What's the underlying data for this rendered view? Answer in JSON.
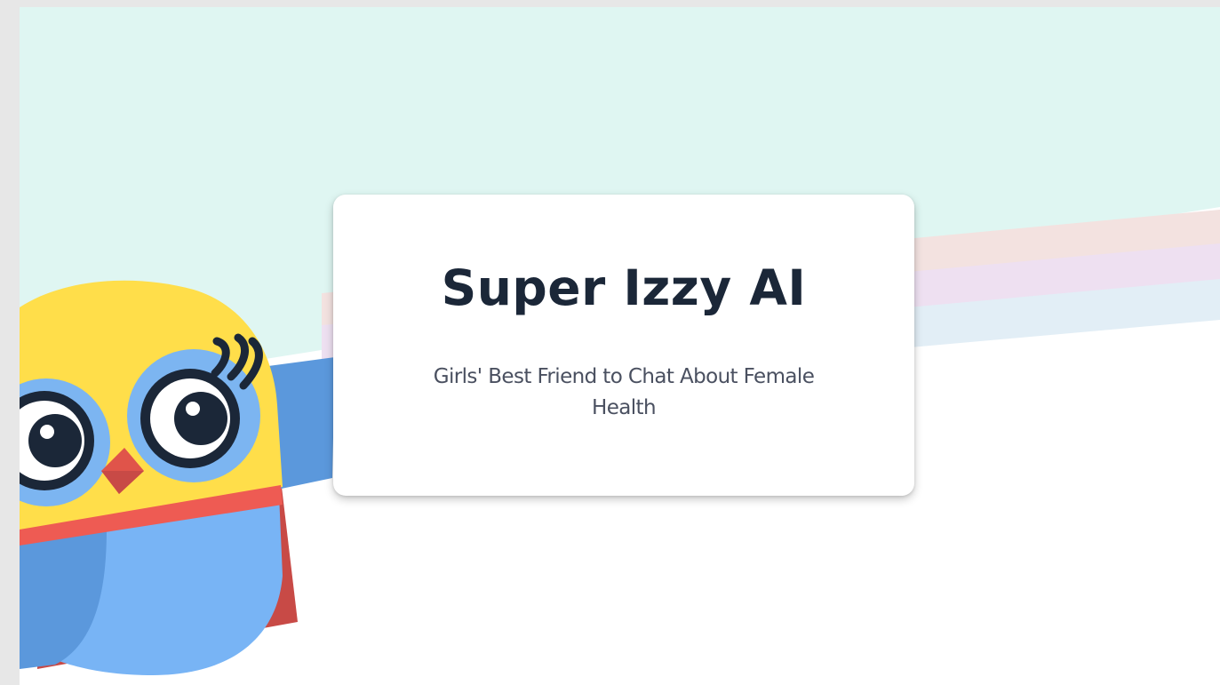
{
  "hero": {
    "title": "Super Izzy AI",
    "subtitle": "Girls' Best Friend to Chat About Female Health"
  },
  "mascot": {
    "icon": "owl-superhero-icon"
  },
  "colors": {
    "hero_background": "#dff6f2",
    "title_text": "#1b2738",
    "subtitle_text": "#4a5060",
    "owl_head": "#ffde4a",
    "owl_body": "#78b4f5",
    "owl_wing": "#5b98dc",
    "owl_beak": "#e0544a",
    "owl_cape": "#c84a46",
    "owl_eye_ring": "#1b2738",
    "rainbow_peach": "#f3e2e0",
    "rainbow_lilac": "#eee0f1",
    "rainbow_sky": "#e2eef6"
  }
}
